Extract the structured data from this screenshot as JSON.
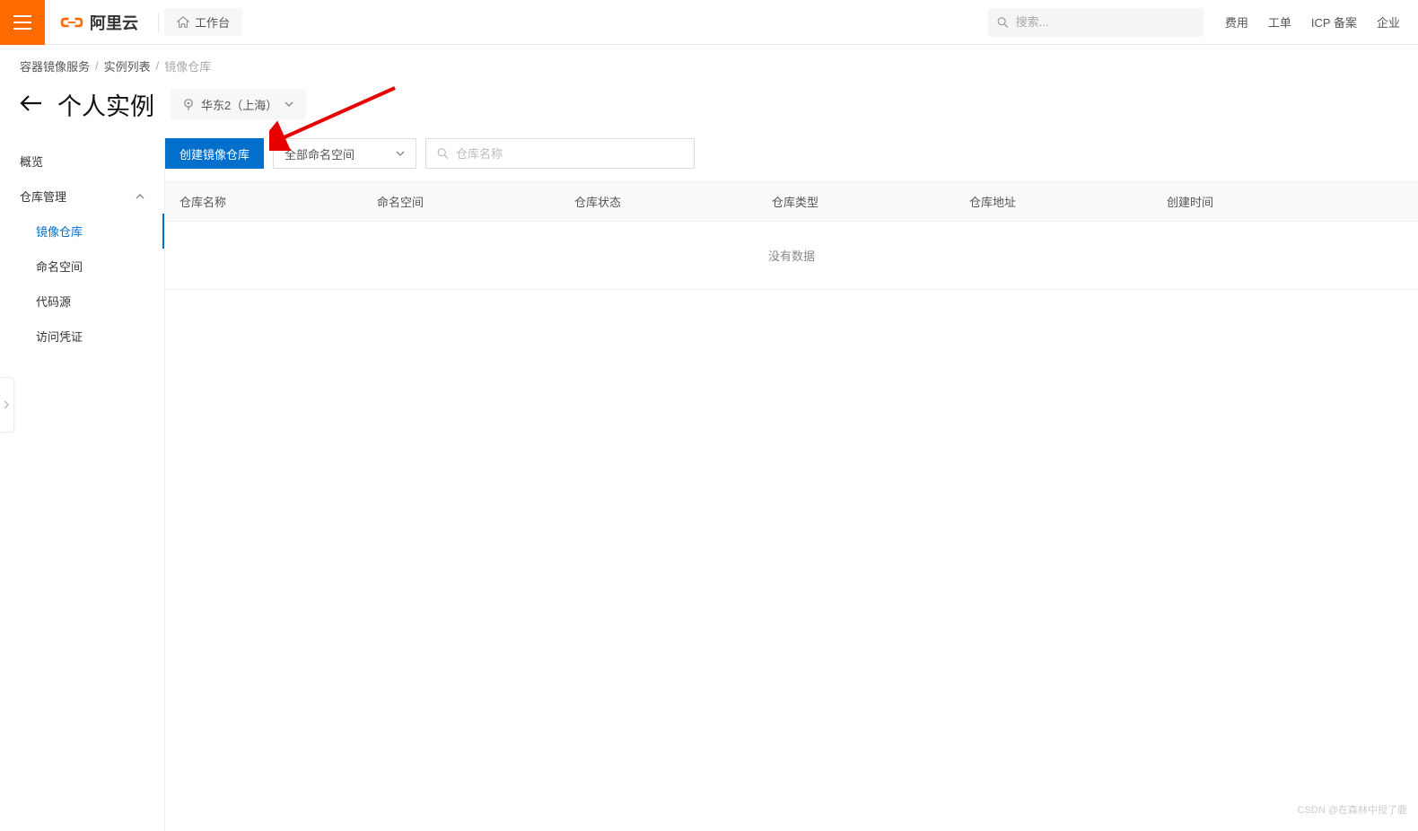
{
  "header": {
    "brand": "阿里云",
    "workbench_label": "工作台",
    "search_placeholder": "搜索...",
    "links": [
      "费用",
      "工单",
      "ICP 备案",
      "企业"
    ]
  },
  "breadcrumb": {
    "items": [
      "容器镜像服务",
      "实例列表",
      "镜像仓库"
    ]
  },
  "page": {
    "title": "个人实例",
    "region": "华东2（上海）"
  },
  "sidebar": {
    "overview": "概览",
    "group": "仓库管理",
    "subs": [
      "镜像仓库",
      "命名空间",
      "代码源",
      "访问凭证"
    ]
  },
  "toolbar": {
    "create_label": "创建镜像仓库",
    "namespace_filter": "全部命名空间",
    "search_placeholder": "仓库名称"
  },
  "table": {
    "headers": [
      "仓库名称",
      "命名空间",
      "仓库状态",
      "仓库类型",
      "仓库地址",
      "创建时间"
    ],
    "empty_text": "没有数据"
  },
  "watermark": "CSDN @在森林中授了鹿"
}
